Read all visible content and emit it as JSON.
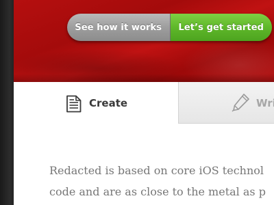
{
  "hero": {
    "buttons": {
      "see_how": "See how it works",
      "get_started": "Let’s get started"
    },
    "colors": {
      "banner_red": "#b50f0f",
      "button_gray": "#9e9e9e",
      "button_green": "#5fb82a"
    }
  },
  "tabs": [
    {
      "label": "Create",
      "icon": "document-icon"
    },
    {
      "label": "Wri",
      "icon": "pen-icon"
    }
  ],
  "body": {
    "lines": [
      "Redacted is based on core iOS technol",
      "code and are as close to the metal as p"
    ]
  }
}
